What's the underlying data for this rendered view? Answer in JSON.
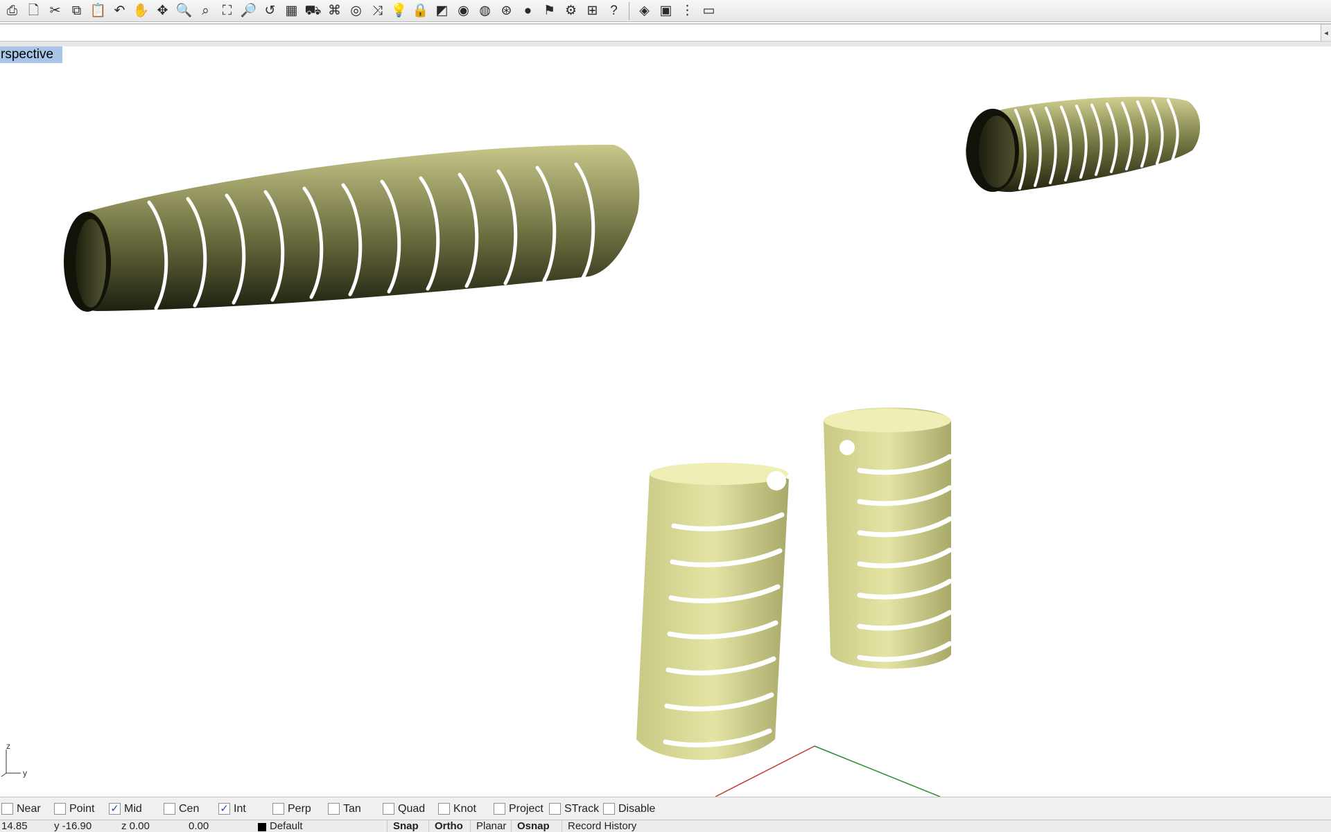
{
  "toolbar": {
    "icons": [
      "print-icon",
      "new-icon",
      "cut-icon",
      "copy-icon",
      "paste-icon",
      "undo-icon",
      "pan-hand-icon",
      "rotate-view-icon",
      "zoom-dynamic-icon",
      "zoom-window-icon",
      "zoom-extents-icon",
      "zoom-selected-icon",
      "undo-view-icon",
      "four-viewports-icon",
      "car-icon",
      "gumball-icon",
      "circle-icon",
      "transform-icon",
      "bulb-icon",
      "lock-icon",
      "layer-icon",
      "color-wheel-icon",
      "sphere-wire-icon",
      "mesh-sphere-icon",
      "render-sphere-icon",
      "flag-icon",
      "gear-icon",
      "options-icon",
      "help-icon",
      "cube-view-icon",
      "box-view-icon",
      "dots-icon",
      "window-icon"
    ],
    "glyphs": [
      "⎙",
      "🗋",
      "✂",
      "⧉",
      "📋",
      "↶",
      "✋",
      "✥",
      "🔍",
      "⌕",
      "⛶",
      "🔎",
      "↺",
      "▦",
      "⛟",
      "⌘",
      "◎",
      "⤨",
      "💡",
      "🔒",
      "◩",
      "◉",
      "◍",
      "⊛",
      "●",
      "⚑",
      "⚙",
      "⊞",
      "?",
      "◈",
      "▣",
      "⋮",
      "▭"
    ]
  },
  "viewport": {
    "title": "rspective",
    "axis_labels": {
      "z": "z",
      "y": "y"
    },
    "object_color": "#d7d78c",
    "object_shade": "#1e2010"
  },
  "osnap": {
    "items": [
      {
        "label": "Near",
        "checked": false
      },
      {
        "label": "Point",
        "checked": false
      },
      {
        "label": "Mid",
        "checked": true
      },
      {
        "label": "Cen",
        "checked": false
      },
      {
        "label": "Int",
        "checked": true
      },
      {
        "label": "Perp",
        "checked": false
      },
      {
        "label": "Tan",
        "checked": false
      },
      {
        "label": "Quad",
        "checked": false
      },
      {
        "label": "Knot",
        "checked": false
      },
      {
        "label": "Project",
        "checked": false
      },
      {
        "label": "STrack",
        "checked": false
      },
      {
        "label": "Disable",
        "checked": false
      }
    ]
  },
  "status": {
    "x": "14.85",
    "y": "y -16.90",
    "z": "z 0.00",
    "distance": "0.00",
    "layer": "Default",
    "panes": [
      {
        "label": "Snap",
        "bold": true
      },
      {
        "label": "Ortho",
        "bold": true
      },
      {
        "label": "Planar",
        "bold": false
      },
      {
        "label": "Osnap",
        "bold": true
      },
      {
        "label": "Record History",
        "bold": false
      }
    ]
  }
}
